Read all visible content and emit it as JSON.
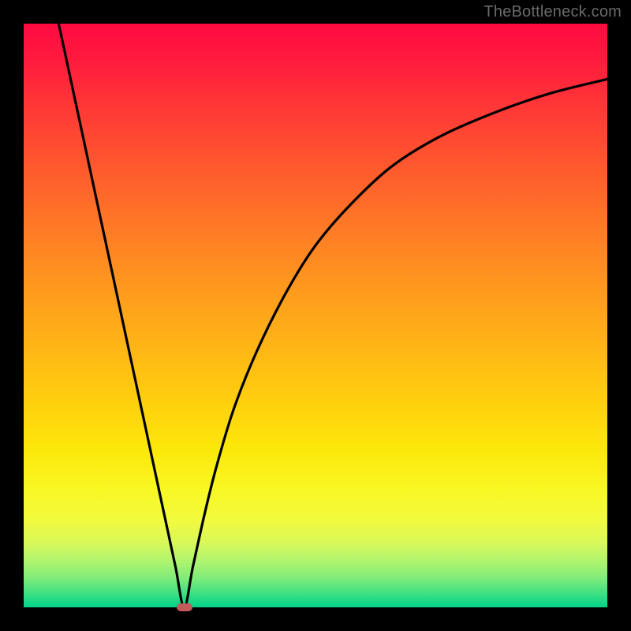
{
  "watermark": "TheBottleneck.com",
  "chart_data": {
    "type": "line",
    "title": "",
    "xlabel": "",
    "ylabel": "",
    "xlim": [
      0,
      100
    ],
    "ylim": [
      0,
      100
    ],
    "background_gradient": {
      "top": "#ff0a42",
      "upper_mid": "#ff981e",
      "lower_mid": "#f8f824",
      "bottom": "#00d488"
    },
    "series": [
      {
        "name": "left-branch",
        "type": "line",
        "x": [
          6,
          8,
          10,
          12,
          14,
          16,
          18,
          20,
          22,
          24,
          26,
          27.5
        ],
        "y": [
          100,
          90.7,
          81.4,
          72.1,
          62.8,
          53.5,
          44.2,
          34.9,
          25.6,
          16.3,
          7.0,
          0
        ]
      },
      {
        "name": "right-branch",
        "type": "line",
        "x": [
          27.5,
          29,
          31,
          33,
          36,
          40,
          45,
          50,
          56,
          63,
          71,
          80,
          90,
          100
        ],
        "y": [
          0,
          7,
          16,
          24,
          34,
          44,
          54,
          62,
          69,
          75.5,
          80.5,
          84.5,
          88,
          90.5
        ]
      }
    ],
    "marker": {
      "name": "minimum-point",
      "x": 27.5,
      "y": 0,
      "color": "#c45a5a"
    }
  }
}
